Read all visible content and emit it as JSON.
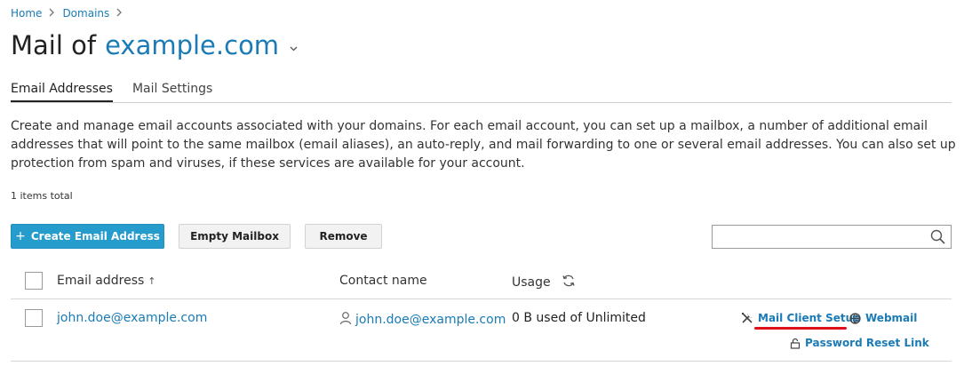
{
  "breadcrumb": {
    "home": "Home",
    "domains": "Domains",
    "sep": ">"
  },
  "header": {
    "title_prefix": "Mail of",
    "domain": "example.com",
    "dropdown_glyph": "⌄"
  },
  "tabs": [
    {
      "label": "Email Addresses",
      "active": true
    },
    {
      "label": "Mail Settings",
      "active": false
    }
  ],
  "description": "Create and manage email accounts associated with your domains. For each email account, you can set up a mailbox, a number of additional email addresses that will point to the same mailbox (email aliases), an auto-reply, and mail forwarding to one or several email addresses. You can also set up protection from spam and viruses, if these services are available for your account.",
  "items_total": "1 items total",
  "toolbar": {
    "create_label": "Create Email Address",
    "create_icon": "+",
    "empty_label": "Empty Mailbox",
    "remove_label": "Remove",
    "search_value": "",
    "search_placeholder": ""
  },
  "table": {
    "columns": {
      "email": "Email address",
      "contact": "Contact name",
      "usage": "Usage",
      "sort_indicator": "↑"
    },
    "rows": [
      {
        "email": "john.doe@example.com",
        "contact": "john.doe@example.com",
        "usage": "0 B used of Unlimited",
        "actions": {
          "mail_client_setup": "Mail Client Setup",
          "webmail": "Webmail",
          "password_reset": "Password Reset Link"
        }
      }
    ]
  },
  "colors": {
    "accent": "#1a7bb6",
    "primary_button": "#259ccc",
    "highlight_underline": "#e0101a"
  },
  "icons": [
    "chevron-right-icon",
    "chevron-down-icon",
    "plus-icon",
    "search-icon",
    "sort-ascending-icon",
    "refresh-icon",
    "person-icon",
    "tools-icon",
    "globe-icon",
    "lock-icon"
  ]
}
